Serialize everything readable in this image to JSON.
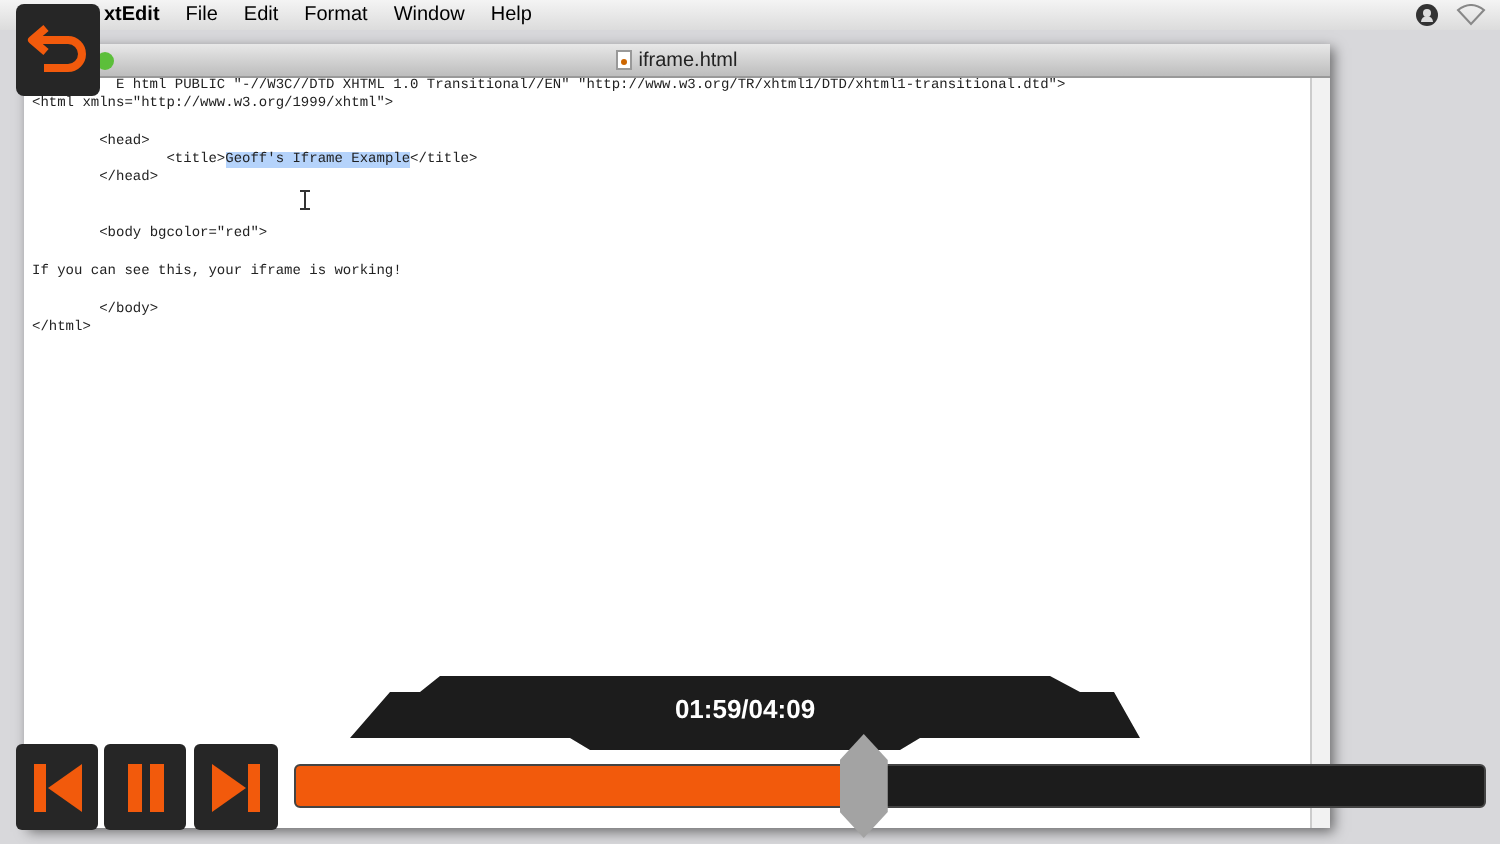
{
  "menu_bar": {
    "app": "xtEdit",
    "items": [
      "File",
      "Edit",
      "Format",
      "Window",
      "Help"
    ]
  },
  "window": {
    "title": "iframe.html"
  },
  "document": {
    "lines": [
      {
        "kind": "text",
        "segments": [
          {
            "text": "E html PUBLIC \"-//W3C//DTD XHTML 1.0 Transitional//EN\" \"http://www.w3.org/TR/xhtml1/DTD/xhtml1-transitional.dtd\">",
            "selected": false
          }
        ]
      },
      {
        "kind": "text",
        "segments": [
          {
            "text": "<html xmlns=\"http://www.w3.org/1999/xhtml\">",
            "selected": false
          }
        ]
      },
      {
        "kind": "blank"
      },
      {
        "kind": "text",
        "segments": [
          {
            "text": "\t<head>",
            "selected": false
          }
        ]
      },
      {
        "kind": "text",
        "segments": [
          {
            "text": "\t\t<title>",
            "selected": false
          },
          {
            "text": "Geoff's Iframe Example",
            "selected": true
          },
          {
            "text": "</title>",
            "selected": false
          }
        ]
      },
      {
        "kind": "text",
        "segments": [
          {
            "text": "\t</head>",
            "selected": false
          }
        ]
      },
      {
        "kind": "blank"
      },
      {
        "kind": "blank"
      },
      {
        "kind": "text",
        "segments": [
          {
            "text": "\t<body bgcolor=\"red\">",
            "selected": false
          }
        ]
      },
      {
        "kind": "blank"
      },
      {
        "kind": "text",
        "segments": [
          {
            "text": "If you can see this, your iframe is working!",
            "selected": false
          }
        ]
      },
      {
        "kind": "blank"
      },
      {
        "kind": "text",
        "segments": [
          {
            "text": "\t</body>",
            "selected": false
          }
        ]
      },
      {
        "kind": "text",
        "segments": [
          {
            "text": "</html>",
            "selected": false
          }
        ]
      }
    ]
  },
  "player": {
    "time": "01:59/04:09",
    "playing": true,
    "progress": {
      "level": 0.478
    }
  }
}
